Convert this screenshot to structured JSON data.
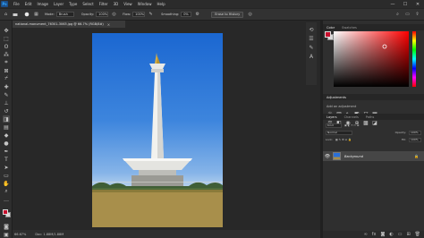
{
  "app": {
    "logo": "Ps"
  },
  "menubar": {
    "items": [
      "File",
      "Edit",
      "Image",
      "Layer",
      "Type",
      "Select",
      "Filter",
      "3D",
      "View",
      "Window",
      "Help"
    ],
    "window_buttons": [
      "—",
      "☐",
      "✕"
    ]
  },
  "options_bar": {
    "mode_label": "Mode:",
    "mode_value": "Brush",
    "opacity_label": "Opacity:",
    "opacity_value": "100%",
    "flow_label": "Flow:",
    "flow_value": "100%",
    "smoothing_label": "Smoothing:",
    "smoothing_value": "0%",
    "erase_button": "Erase to History"
  },
  "document": {
    "tab_label": "national-monument_76301-3063.jpg @ 66.7% (RGB/8#)",
    "close_glyph": "×",
    "zoom": "66.67%",
    "doc_info": "Doc: 1.88M/1.88M"
  },
  "panels": {
    "color": {
      "tabs": [
        "Color",
        "Swatches"
      ],
      "fg_color": "#c8102e",
      "bg_color": "#d9d9d9"
    },
    "adjustments": {
      "tabs": [
        "Adjustments"
      ],
      "add_label": "Add an adjustment"
    },
    "layers": {
      "tabs": [
        "Layers",
        "Channels",
        "Paths"
      ],
      "kind_label": "Kind",
      "blend_mode": "Normal",
      "opacity_label": "Opacity:",
      "opacity_value": "100%",
      "lock_label": "Lock:",
      "fill_label": "Fill:",
      "fill_value": "100%",
      "layer_name": "Background",
      "lock_glyph": "🔒"
    }
  },
  "icons": {
    "toolbar": [
      "move-icon",
      "marquee-icon",
      "lasso-icon",
      "quick-select-icon",
      "crop-icon",
      "frame-icon",
      "eyedropper-icon",
      "healing-brush-icon",
      "brush-icon",
      "clone-stamp-icon",
      "history-brush-icon",
      "eraser-icon",
      "gradient-icon",
      "blur-icon",
      "dodge-icon",
      "pen-icon",
      "type-icon",
      "path-select-icon",
      "rectangle-icon",
      "hand-icon",
      "zoom-icon",
      "more-tools-icon"
    ]
  }
}
